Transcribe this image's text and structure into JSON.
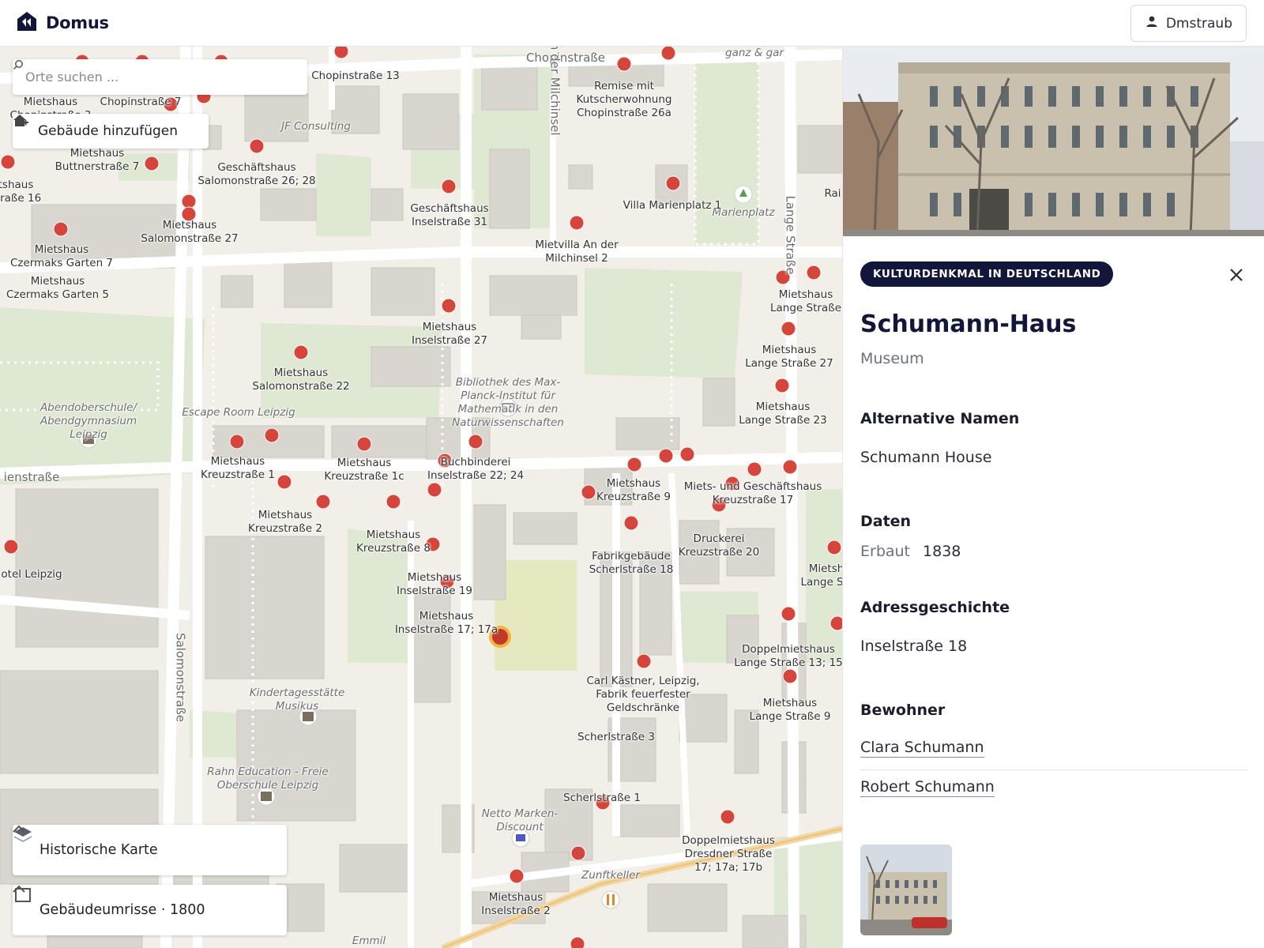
{
  "app": {
    "name": "Domus"
  },
  "header": {
    "user_label": "Dmstraub"
  },
  "map": {
    "search_placeholder": "Orte suchen ...",
    "add_building_label": "Gebäude hinzufügen",
    "layer_historic_label": "Historische Karte",
    "layer_outlines_label": "Gebäudeumrisse · 1800",
    "labels": [
      {
        "t": "Chopinstraße 13"
      },
      {
        "t": "Chopinstraße"
      },
      {
        "t": "Remise mit\nKutscherwohnung\nChopinstraße 26a"
      },
      {
        "t": "Mietshaus\nChopinstraße 3"
      },
      {
        "t": "Chopinstraße 7"
      },
      {
        "t": "JF Consulting"
      },
      {
        "t": "An der Milchinsel"
      },
      {
        "t": "Marienplatz"
      },
      {
        "t": "Mietshaus\nButtnerstraße 7"
      },
      {
        "t": "Geschäftshaus\nSalomonstraße 26; 28"
      },
      {
        "t": "tshaus\nstraße 16"
      },
      {
        "t": "Villa Marienplatz 1"
      },
      {
        "t": "Geschäftshaus\nInselstraße 31"
      },
      {
        "t": "Lange Straße"
      },
      {
        "t": "Mietshaus\nSalomonstraße 27"
      },
      {
        "t": "Mietvilla An der\nMilchinsel 2"
      },
      {
        "t": "Mietshaus\nCzermaks Garten 7"
      },
      {
        "t": "Mietshaus\nCzermaks Garten 5"
      },
      {
        "t": "Mietshaus\nLange Straße"
      },
      {
        "t": "Mietshaus\nInselstraße 27"
      },
      {
        "t": "Mietshaus\nLange Straße 27"
      },
      {
        "t": "Mietshaus\nSalomonstraße 22"
      },
      {
        "t": "Bibliothek des Max-\nPlanck-Institut für\nMathematik in den\nNaturwissenschaften"
      },
      {
        "t": "Abendoberschule/\nAbendgymnasium\nLeipzig"
      },
      {
        "t": "Escape Room Leipzig"
      },
      {
        "t": "Mietshaus\nLange Straße 23"
      },
      {
        "t": "ienstraße"
      },
      {
        "t": "Mietshaus\nKreuzstraße 1"
      },
      {
        "t": "Mietshaus\nKreuzstraße 1c"
      },
      {
        "t": "Buchbinderei\nInselstraße 22; 24"
      },
      {
        "t": "Mietshaus\nKreuzstraße 9"
      },
      {
        "t": "Miets- und Geschäftshaus\nKreuzstraße 17"
      },
      {
        "t": "Mietshaus\nKreuzstraße 2"
      },
      {
        "t": "Mietshaus\nKreuzstraße 8"
      },
      {
        "t": "Druckerei\nKreuzstraße 20"
      },
      {
        "t": "Fabrikgebäude\nScherlstraße 18"
      },
      {
        "t": "otel Leipzig"
      },
      {
        "t": "Mietshaus\nInselstraße 19"
      },
      {
        "t": "Mietsh\nLange Str"
      },
      {
        "t": "Mietshaus\nInselstraße 17; 17a"
      },
      {
        "t": "Salomonstraße"
      },
      {
        "t": "Doppelmietshaus\nLange Straße 13; 15"
      },
      {
        "t": "Kindertagesstätte\nMusikus"
      },
      {
        "t": "Carl Kästner, Leipzig,\nFabrik feuerfester\nGeldschränke"
      },
      {
        "t": "Mietshaus\nLange Straße 9"
      },
      {
        "t": "Scherlstraße 3"
      },
      {
        "t": "Rahn Education - Freie\nOberschule Leipzig"
      },
      {
        "t": "Scherlstraße 1"
      },
      {
        "t": "Netto Marken-\nDiscount"
      },
      {
        "t": "Doppelmietshaus\nDresdner Straße\n17; 17a; 17b"
      },
      {
        "t": "Zunftkeller"
      },
      {
        "t": "Mietshaus\nInselstraße 2"
      },
      {
        "t": "Emmil"
      },
      {
        "t": "ganz & gar"
      },
      {
        "t": "Rai"
      }
    ]
  },
  "detail": {
    "badge": "KULTURDENKMAL IN DEUTSCHLAND",
    "title": "Schumann-Haus",
    "subtitle": "Museum",
    "alt_names_heading": "Alternative Namen",
    "alt_names_value": "Schumann House",
    "data_heading": "Daten",
    "built_label": "Erbaut",
    "built_value": "1838",
    "address_heading": "Adressgeschichte",
    "address_value": "Inselstraße 18",
    "residents_heading": "Bewohner",
    "residents": [
      "Clara Schumann",
      "Robert Schumann"
    ]
  },
  "colors": {
    "brand": "#12163a",
    "marker": "#d6453b",
    "selected_marker": "#c0392b",
    "selected_ring": "#f2b33d"
  },
  "icons": [
    "domus-logo-icon",
    "user-icon",
    "search-icon",
    "home-add-icon",
    "layers-icon",
    "square-icon",
    "chevron-up-icon",
    "close-icon"
  ]
}
